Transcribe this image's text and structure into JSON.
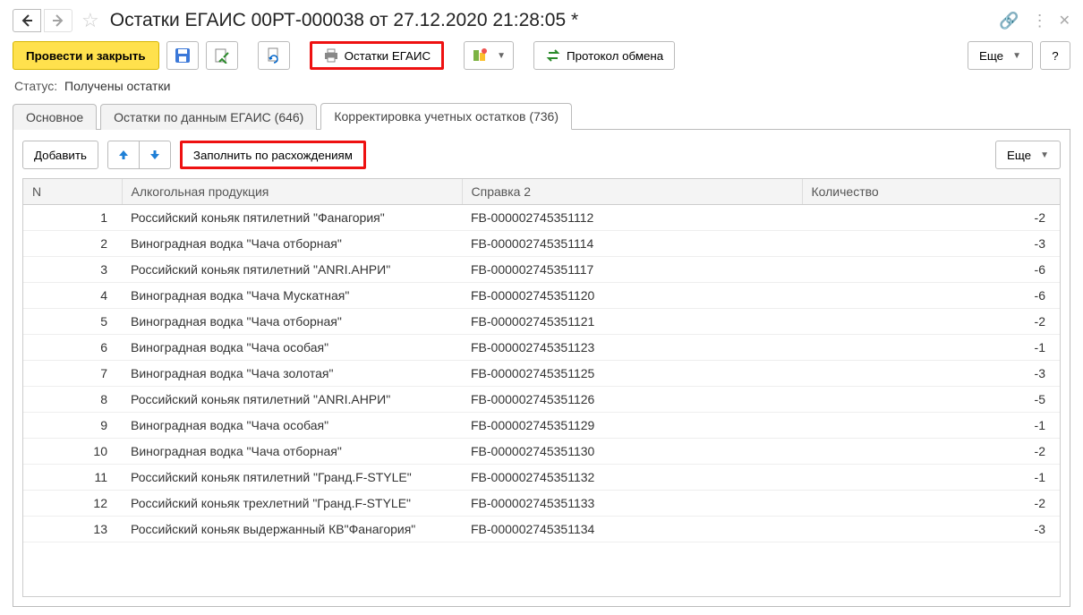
{
  "title": "Остатки ЕГАИС 00РТ-000038 от 27.12.2020 21:28:05 *",
  "toolbar": {
    "post_and_close_label": "Провести и закрыть",
    "print_label": "Остатки ЕГАИС",
    "exchange_label": "Протокол обмена",
    "more_label": "Еще",
    "help_label": "?"
  },
  "status": {
    "label": "Статус:",
    "value": "Получены остатки"
  },
  "tabs": [
    {
      "label": "Основное"
    },
    {
      "label": "Остатки по данным ЕГАИС (646)"
    },
    {
      "label": "Корректировка учетных остатков (736)"
    }
  ],
  "inner_toolbar": {
    "add_label": "Добавить",
    "fill_label": "Заполнить по расхождениям",
    "more_label": "Еще"
  },
  "table": {
    "columns": {
      "n": "N",
      "product": "Алкогольная продукция",
      "ref": "Справка 2",
      "qty": "Количество"
    },
    "rows": [
      {
        "n": 1,
        "product": "Российский коньяк пятилетний \"Фанагория\"",
        "ref": "FB-000002745351112",
        "qty": -2
      },
      {
        "n": 2,
        "product": "Виноградная водка \"Чача отборная\"",
        "ref": "FB-000002745351114",
        "qty": -3
      },
      {
        "n": 3,
        "product": "Российский коньяк пятилетний \"ANRI.АНРИ\"",
        "ref": "FB-000002745351117",
        "qty": -6
      },
      {
        "n": 4,
        "product": "Виноградная водка \"Чача Мускатная\"",
        "ref": "FB-000002745351120",
        "qty": -6
      },
      {
        "n": 5,
        "product": "Виноградная водка \"Чача отборная\"",
        "ref": "FB-000002745351121",
        "qty": -2
      },
      {
        "n": 6,
        "product": "Виноградная водка \"Чача особая\"",
        "ref": "FB-000002745351123",
        "qty": -1
      },
      {
        "n": 7,
        "product": "Виноградная водка \"Чача золотая\"",
        "ref": "FB-000002745351125",
        "qty": -3
      },
      {
        "n": 8,
        "product": "Российский коньяк пятилетний \"ANRI.АНРИ\"",
        "ref": "FB-000002745351126",
        "qty": -5
      },
      {
        "n": 9,
        "product": "Виноградная водка \"Чача особая\"",
        "ref": "FB-000002745351129",
        "qty": -1
      },
      {
        "n": 10,
        "product": "Виноградная водка \"Чача отборная\"",
        "ref": "FB-000002745351130",
        "qty": -2
      },
      {
        "n": 11,
        "product": "Российский коньяк пятилетний \"Гранд.F-STYLE\"",
        "ref": "FB-000002745351132",
        "qty": -1
      },
      {
        "n": 12,
        "product": "Российский коньяк трехлетний \"Гранд.F-STYLE\"",
        "ref": "FB-000002745351133",
        "qty": -2
      },
      {
        "n": 13,
        "product": "Российский коньяк выдержанный КВ\"Фанагория\"",
        "ref": "FB-000002745351134",
        "qty": -3
      }
    ]
  }
}
